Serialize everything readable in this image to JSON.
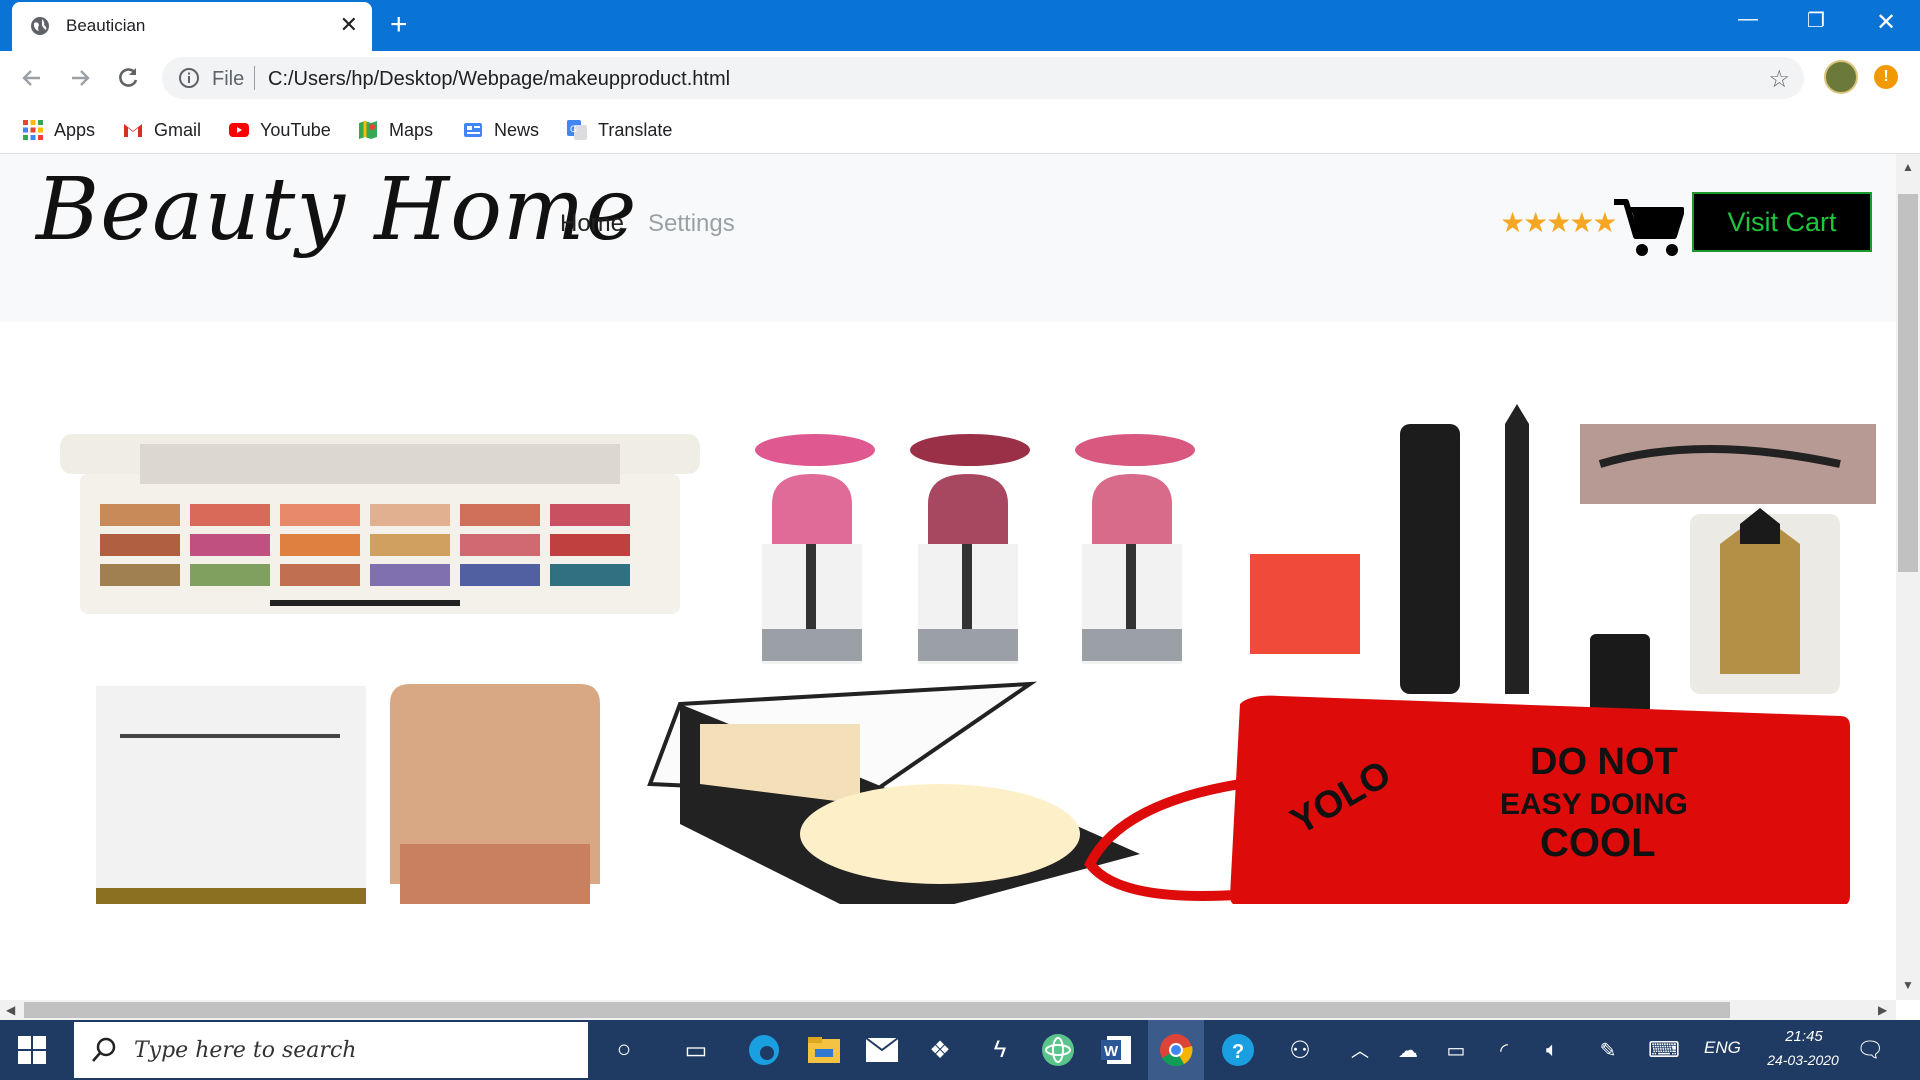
{
  "browser": {
    "tab_title": "Beautician",
    "address_scheme": "File",
    "address_url": "C:/Users/hp/Desktop/Webpage/makeupproduct.html",
    "bookmarks": [
      "Apps",
      "Gmail",
      "YouTube",
      "Maps",
      "News",
      "Translate"
    ]
  },
  "site": {
    "logo": "Beauty Home",
    "nav": {
      "home": "Home",
      "settings": "Settings"
    },
    "rating_stars": "★★★★★",
    "rating": 5,
    "visit_cart": "Visit Cart",
    "hero_products": [
      "eyeshadow-palette",
      "lipsticks",
      "mascara-eyeliner",
      "kajal",
      "foundation-box",
      "foundation-tube",
      "compact-powder",
      "red-pouch"
    ],
    "pouch_text": [
      "YOLO",
      "DO NOT",
      "EASY DOING",
      "COOL"
    ]
  },
  "taskbar": {
    "search_placeholder": "Type here to search",
    "language": "ENG",
    "time": "21:45",
    "date": "24-03-2020"
  },
  "colors": {
    "titlebar": "#0a74d6",
    "accent_green": "#1fc63a",
    "star": "#f5a623",
    "taskbar": "#1f3b63"
  }
}
